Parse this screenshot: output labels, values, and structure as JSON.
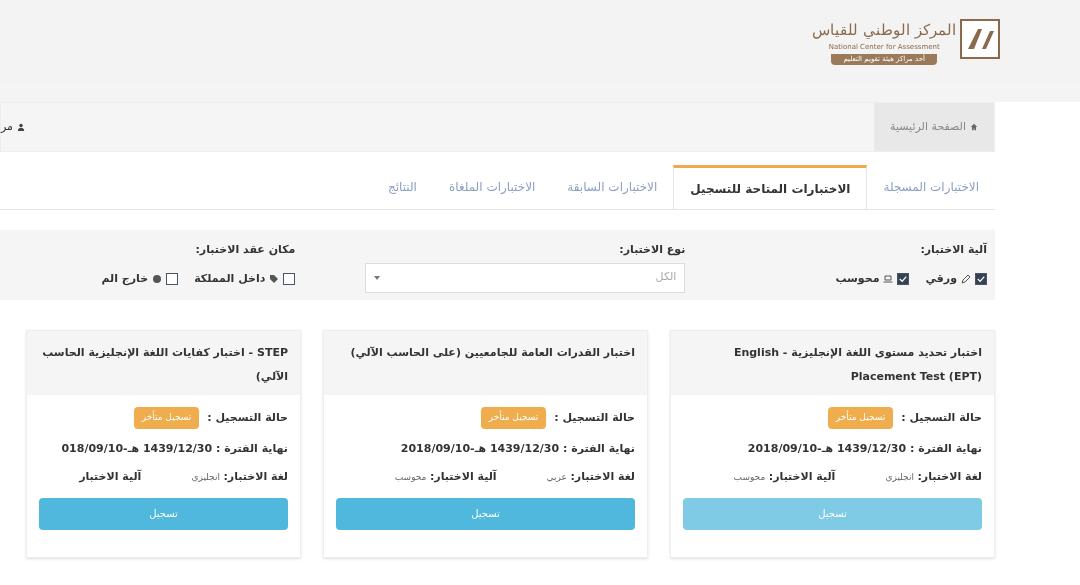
{
  "header": {
    "logo_title": "المركز الوطني للقياس",
    "logo_subtitle": "National Center for Assessment",
    "logo_tagline": "أحد مراكز هيئة تقويم التعليم"
  },
  "breadcrumb": {
    "home": "الصفحة الرئيسية",
    "user": "مر"
  },
  "tabs": [
    {
      "label": "الاختبارات المسجلة",
      "selected": false
    },
    {
      "label": "الاختبارات المتاحة للتسجيل",
      "selected": true
    },
    {
      "label": "الاختبارات السابقة",
      "selected": false
    },
    {
      "label": "الاختبارات الملغاة",
      "selected": false
    },
    {
      "label": "النتائج",
      "selected": false
    }
  ],
  "filters": {
    "mechanism": {
      "label": "آلية الاختبار:",
      "options": [
        {
          "label": "ورقي",
          "checked": true
        },
        {
          "label": "محوسب",
          "checked": true
        }
      ]
    },
    "type": {
      "label": "نوع الاختبار:",
      "value": "الكل"
    },
    "place": {
      "label": "مكان عقد الاختبار:",
      "options": [
        {
          "label": "داخل المملكة",
          "checked": false
        },
        {
          "label": "خارج الم",
          "checked": false
        }
      ]
    }
  },
  "cards": [
    {
      "title": "اختبار تحديد مستوى اللغة الإنجليزية - English Placement Test (EPT)",
      "status_label": "حالة التسجيل :",
      "status": "تسجيل متأخر",
      "period": "نهاية الفترة : 1439/12/30 هـ-2018/09/10",
      "language_label": "لغة الاختبار:",
      "language": "انجليزي",
      "mechanism_label": "آلية الاختبار:",
      "mechanism": "محوسب",
      "button": "تسجيل"
    },
    {
      "title": "اختبار القدرات العامة للجامعيين (على الحاسب الآلي)",
      "status_label": "حالة التسجيل :",
      "status": "تسجيل متأخر",
      "period": "نهاية الفترة : 1439/12/30 هـ-2018/09/10",
      "language_label": "لغة الاختبار:",
      "language": "عربي",
      "mechanism_label": "آلية الاختبار:",
      "mechanism": "محوسب",
      "button": "تسجيل"
    },
    {
      "title": "STEP - اختبار كفايات اللغة الإنجليزية الحاسب الآلي)",
      "status_label": "حالة التسجيل :",
      "status": "تسجيل متأخر",
      "period": "نهاية الفترة : 1439/12/30 هـ-018/09/10",
      "language_label": "لغة الاختبار:",
      "language": "انجليزي",
      "mechanism_label": "آلية الاختبار",
      "button": "تسجيل"
    }
  ]
}
